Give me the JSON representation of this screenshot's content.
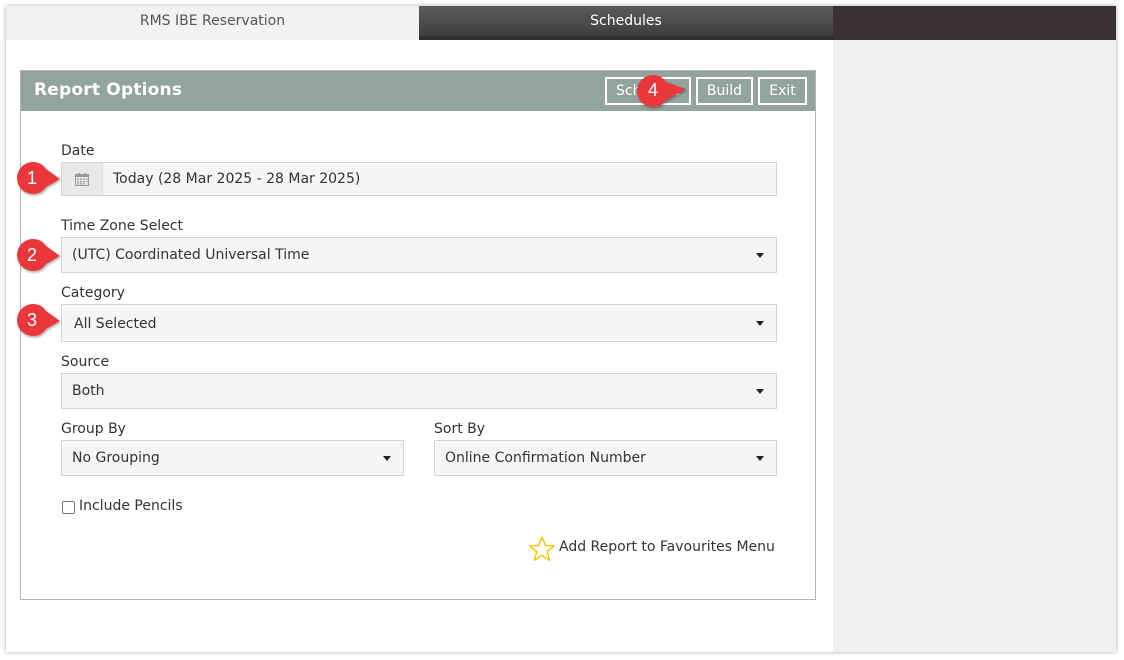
{
  "tabs": {
    "rms_ibe": "RMS IBE Reservation",
    "schedules": "Schedules"
  },
  "panel": {
    "title": "Report Options",
    "buttons": {
      "schedule": "Schedule",
      "build": "Build",
      "exit": "Exit"
    }
  },
  "form": {
    "date": {
      "label": "Date",
      "value": "Today (28 Mar 2025 - 28 Mar 2025)"
    },
    "time_zone": {
      "label": "Time Zone Select",
      "value": "(UTC) Coordinated Universal Time"
    },
    "category": {
      "label": "Category",
      "value": "All Selected"
    },
    "source": {
      "label": "Source",
      "value": "Both"
    },
    "group_by": {
      "label": "Group By",
      "value": "No Grouping"
    },
    "sort_by": {
      "label": "Sort By",
      "value": "Online Confirmation Number"
    },
    "include_pencils": {
      "label": "Include Pencils",
      "checked": false
    },
    "favourites": {
      "label": "Add Report to Favourites Menu"
    }
  },
  "callouts": [
    "1",
    "2",
    "3",
    "4"
  ],
  "colors": {
    "header": "#93a39f",
    "callout": "#e8393b",
    "tab_dark": "#3b3032",
    "star": "#f2c200"
  }
}
